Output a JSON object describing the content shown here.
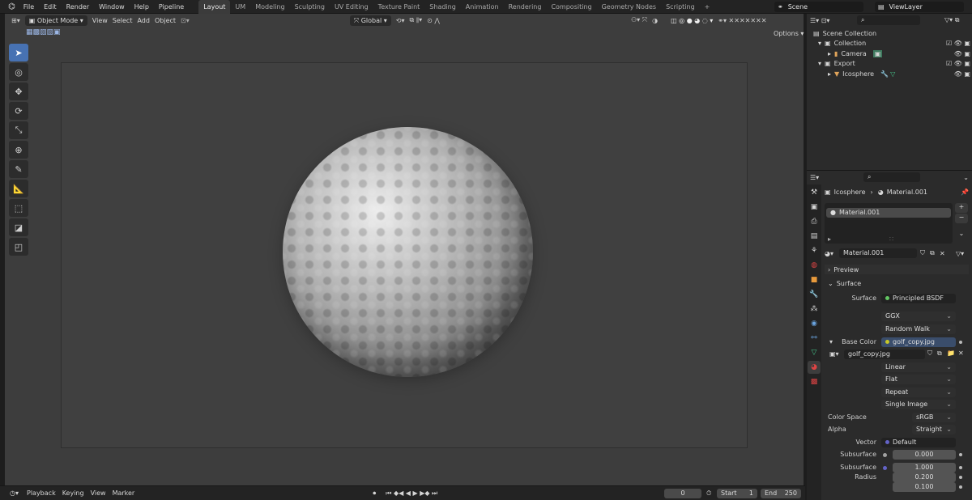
{
  "topbar": {
    "menu": [
      "File",
      "Edit",
      "Render",
      "Window",
      "Help",
      "Pipeline"
    ],
    "workspaces": [
      "Layout",
      "UM",
      "Modeling",
      "Sculpting",
      "UV Editing",
      "Texture Paint",
      "Shading",
      "Animation",
      "Rendering",
      "Compositing",
      "Geometry Nodes",
      "Scripting"
    ],
    "add_ws": "+",
    "scene": "Scene",
    "viewlayer": "ViewLayer"
  },
  "viewport_header": {
    "mode": "Object Mode",
    "menus": [
      "View",
      "Select",
      "Add",
      "Object"
    ],
    "orientation": "Global",
    "options": "Options"
  },
  "outliner": {
    "root": "Scene Collection",
    "items": [
      {
        "label": "Collection",
        "icon": "collection-icon"
      },
      {
        "label": "Camera",
        "icon": "camera-icon"
      },
      {
        "label": "Export",
        "icon": "collection-icon"
      },
      {
        "label": "Icosphere",
        "icon": "mesh-icon"
      }
    ]
  },
  "properties": {
    "breadcrumb_obj": "Icosphere",
    "breadcrumb_mat": "Material.001",
    "slot": "Material.001",
    "material": "Material.001",
    "preview": "Preview",
    "surface_panel": "Surface",
    "surface_label": "Surface",
    "surface_value": "Principled BSDF",
    "distribution": "GGX",
    "subsurface_method": "Random Walk",
    "base_color_label": "Base Color",
    "base_color_value": "golf_copy.jpg",
    "image_name": "golf_copy.jpg",
    "interp": "Linear",
    "projection": "Flat",
    "extension": "Repeat",
    "source": "Single Image",
    "color_space_label": "Color Space",
    "color_space": "sRGB",
    "alpha_label": "Alpha",
    "alpha": "Straight",
    "vector_label": "Vector",
    "vector": "Default",
    "subsurface_label": "Subsurface",
    "subsurface": "0.000",
    "subsurface_radius_label": "Subsurface Radius",
    "radius": [
      "1.000",
      "0.200",
      "0.100"
    ]
  },
  "timeline": {
    "menus": [
      "Playback",
      "Keying",
      "View",
      "Marker"
    ],
    "current": "0",
    "start_label": "Start",
    "start": "1",
    "end_label": "End",
    "end": "250"
  },
  "colors": {
    "accent": "#4772b3",
    "socket_green": "#63c763",
    "socket_blue": "#6363c7",
    "socket_yellow": "#c7c729",
    "socket_grey": "#a1a1a1"
  }
}
